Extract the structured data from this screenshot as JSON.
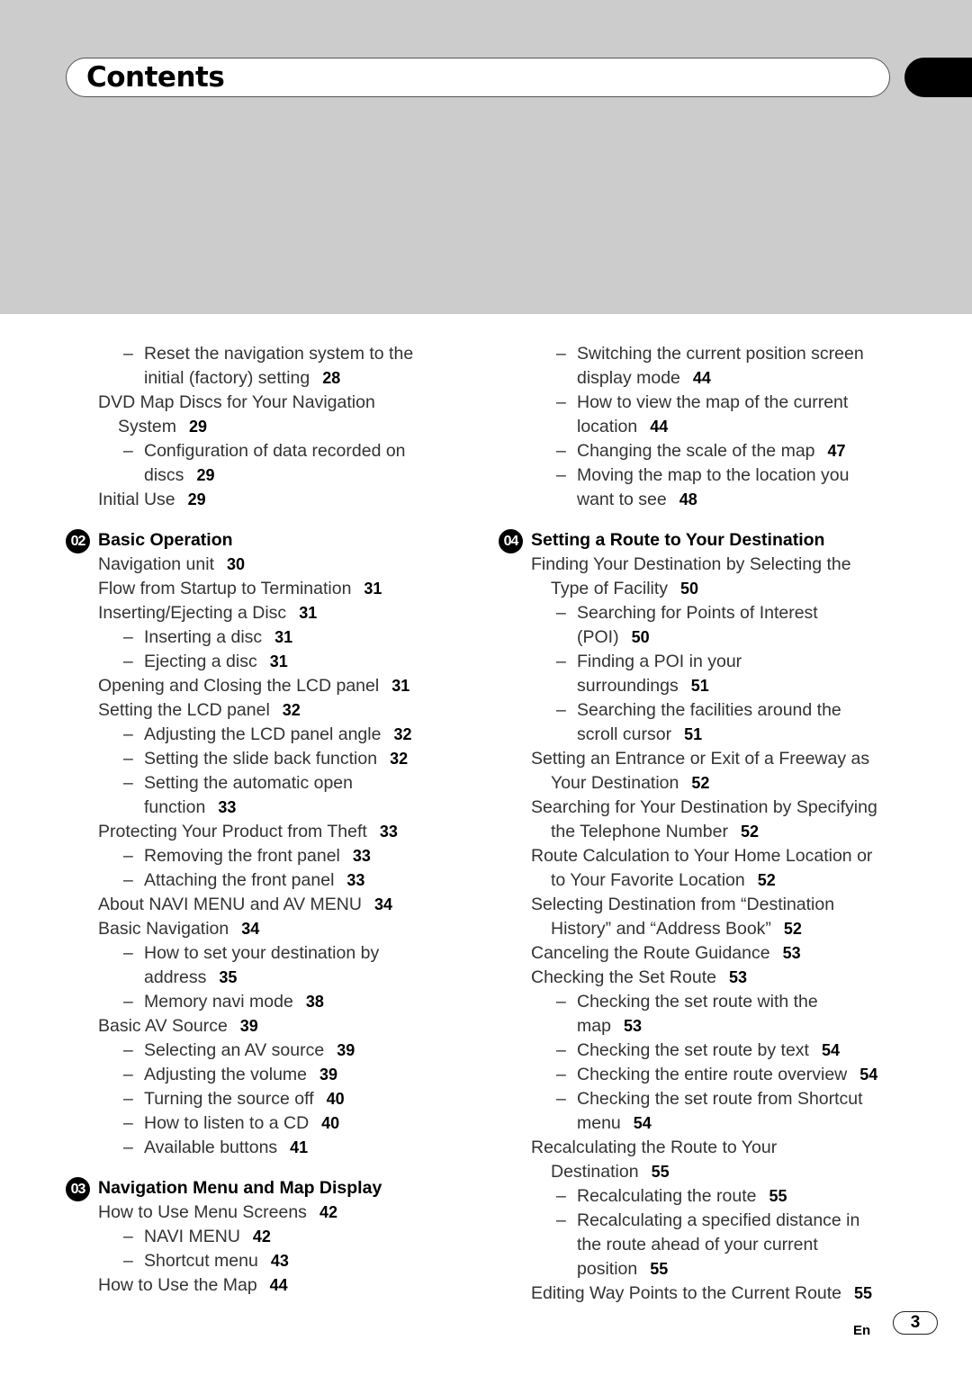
{
  "header": {
    "title": "Contents"
  },
  "left_column": [
    {
      "type": "l2",
      "lines": [
        "Reset the navigation system to the",
        "initial (factory) setting"
      ],
      "page": "28"
    },
    {
      "type": "l1",
      "lines": [
        "DVD Map Discs for Your Navigation",
        "System"
      ],
      "page": "29"
    },
    {
      "type": "l2",
      "lines": [
        "Configuration of data recorded on",
        "discs"
      ],
      "page": "29"
    },
    {
      "type": "l1",
      "lines": [
        "Initial Use"
      ],
      "page": "29"
    },
    {
      "type": "section",
      "number": "02",
      "title": "Basic Operation"
    },
    {
      "type": "l1",
      "lines": [
        "Navigation unit"
      ],
      "page": "30"
    },
    {
      "type": "l1",
      "lines": [
        "Flow from Startup to Termination"
      ],
      "page": "31"
    },
    {
      "type": "l1",
      "lines": [
        "Inserting/Ejecting a Disc"
      ],
      "page": "31"
    },
    {
      "type": "l2",
      "lines": [
        "Inserting a disc"
      ],
      "page": "31"
    },
    {
      "type": "l2",
      "lines": [
        "Ejecting a disc"
      ],
      "page": "31"
    },
    {
      "type": "l1",
      "lines": [
        "Opening and Closing the LCD panel"
      ],
      "page": "31"
    },
    {
      "type": "l1",
      "lines": [
        "Setting the LCD panel"
      ],
      "page": "32"
    },
    {
      "type": "l2",
      "lines": [
        "Adjusting the LCD panel angle"
      ],
      "page": "32"
    },
    {
      "type": "l2",
      "lines": [
        "Setting the slide back function"
      ],
      "page": "32"
    },
    {
      "type": "l2",
      "lines": [
        "Setting the automatic open",
        "function"
      ],
      "page": "33"
    },
    {
      "type": "l1",
      "lines": [
        "Protecting Your Product from Theft"
      ],
      "page": "33"
    },
    {
      "type": "l2",
      "lines": [
        "Removing the front panel"
      ],
      "page": "33"
    },
    {
      "type": "l2",
      "lines": [
        "Attaching the front panel"
      ],
      "page": "33"
    },
    {
      "type": "l1",
      "lines": [
        "About NAVI MENU and AV MENU"
      ],
      "page": "34"
    },
    {
      "type": "l1",
      "lines": [
        "Basic Navigation"
      ],
      "page": "34"
    },
    {
      "type": "l2",
      "lines": [
        "How to set your destination by",
        "address"
      ],
      "page": "35"
    },
    {
      "type": "l2",
      "lines": [
        "Memory navi mode"
      ],
      "page": "38"
    },
    {
      "type": "l1",
      "lines": [
        "Basic AV Source"
      ],
      "page": "39"
    },
    {
      "type": "l2",
      "lines": [
        "Selecting an AV source"
      ],
      "page": "39"
    },
    {
      "type": "l2",
      "lines": [
        "Adjusting the volume"
      ],
      "page": "39"
    },
    {
      "type": "l2",
      "lines": [
        "Turning the source off"
      ],
      "page": "40"
    },
    {
      "type": "l2",
      "lines": [
        "How to listen to a CD"
      ],
      "page": "40"
    },
    {
      "type": "l2",
      "lines": [
        "Available buttons"
      ],
      "page": "41"
    },
    {
      "type": "section",
      "number": "03",
      "title": "Navigation Menu and Map Display"
    },
    {
      "type": "l1",
      "lines": [
        "How to Use Menu Screens"
      ],
      "page": "42"
    },
    {
      "type": "l2",
      "lines": [
        "NAVI MENU"
      ],
      "page": "42"
    },
    {
      "type": "l2",
      "lines": [
        "Shortcut menu"
      ],
      "page": "43"
    },
    {
      "type": "l1",
      "lines": [
        "How to Use the Map"
      ],
      "page": "44"
    }
  ],
  "right_column": [
    {
      "type": "l2",
      "lines": [
        "Switching the current position screen",
        "display mode"
      ],
      "page": "44"
    },
    {
      "type": "l2",
      "lines": [
        "How to view the map of the current",
        "location"
      ],
      "page": "44"
    },
    {
      "type": "l2",
      "lines": [
        "Changing the scale of the map"
      ],
      "page": "47"
    },
    {
      "type": "l2",
      "lines": [
        "Moving the map to the location you",
        "want to see"
      ],
      "page": "48"
    },
    {
      "type": "section",
      "number": "04",
      "title": "Setting a Route to Your Destination"
    },
    {
      "type": "l1",
      "lines": [
        "Finding Your Destination by Selecting the",
        "Type of Facility"
      ],
      "page": "50"
    },
    {
      "type": "l2",
      "lines": [
        "Searching for Points of Interest",
        "(POI)"
      ],
      "page": "50"
    },
    {
      "type": "l2",
      "lines": [
        "Finding a POI in your",
        "surroundings"
      ],
      "page": "51"
    },
    {
      "type": "l2",
      "lines": [
        "Searching the facilities around the",
        "scroll cursor"
      ],
      "page": "51"
    },
    {
      "type": "l1",
      "lines": [
        "Setting an Entrance or Exit of a Freeway as",
        "Your Destination"
      ],
      "page": "52"
    },
    {
      "type": "l1",
      "lines": [
        "Searching for Your Destination by Specifying",
        "the Telephone Number"
      ],
      "page": "52"
    },
    {
      "type": "l1",
      "lines": [
        "Route Calculation to Your Home Location or",
        "to Your Favorite Location"
      ],
      "page": "52"
    },
    {
      "type": "l1",
      "lines": [
        "Selecting Destination from “Destination",
        "History” and “Address Book”"
      ],
      "page": "52"
    },
    {
      "type": "l1",
      "lines": [
        "Canceling the Route Guidance"
      ],
      "page": "53"
    },
    {
      "type": "l1",
      "lines": [
        "Checking the Set Route"
      ],
      "page": "53"
    },
    {
      "type": "l2",
      "lines": [
        "Checking the set route with the",
        "map"
      ],
      "page": "53"
    },
    {
      "type": "l2",
      "lines": [
        "Checking the set route by text"
      ],
      "page": "54"
    },
    {
      "type": "l2",
      "lines": [
        "Checking the entire route overview"
      ],
      "page": "54"
    },
    {
      "type": "l2",
      "lines": [
        "Checking the set route from Shortcut",
        "menu"
      ],
      "page": "54"
    },
    {
      "type": "l1",
      "lines": [
        "Recalculating the Route to Your",
        "Destination"
      ],
      "page": "55"
    },
    {
      "type": "l2",
      "lines": [
        "Recalculating the route"
      ],
      "page": "55"
    },
    {
      "type": "l2",
      "lines": [
        "Recalculating a specified distance in",
        "the route ahead of your current",
        "position"
      ],
      "page": "55"
    },
    {
      "type": "l1",
      "lines": [
        "Editing Way Points to the Current Route"
      ],
      "page": "55"
    }
  ],
  "dash_glyph": "–",
  "footer": {
    "language": "En",
    "page_number": "3"
  }
}
